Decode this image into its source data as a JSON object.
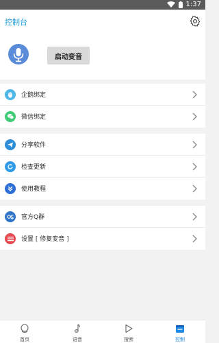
{
  "status_bar": {
    "time": "1:37"
  },
  "header": {
    "title": "控制台"
  },
  "hero": {
    "start_button_label": "启动变音"
  },
  "groups": [
    {
      "items": [
        {
          "label": "企鹅绑定",
          "icon": "penguin-icon",
          "color": "#4fb6e8"
        },
        {
          "label": "微信绑定",
          "icon": "wechat-icon",
          "color": "#3fca76"
        }
      ]
    },
    {
      "items": [
        {
          "label": "分享软件",
          "icon": "share-icon",
          "color": "#2f8ed8"
        },
        {
          "label": "检查更新",
          "icon": "refresh-icon",
          "color": "#2f9ae8"
        },
        {
          "label": "使用教程",
          "icon": "tutorial-icon",
          "color": "#2d6fd6"
        }
      ]
    },
    {
      "items": [
        {
          "label": "官方Q群",
          "icon": "group-icon",
          "color": "#2e75c9"
        },
        {
          "label": "设置 [ 修复变音 ]",
          "icon": "settings-list-icon",
          "color": "#e6484f"
        }
      ]
    }
  ],
  "tabs": [
    {
      "label": "首页",
      "icon": "home-icon",
      "active": false
    },
    {
      "label": "语音",
      "icon": "music-note-icon",
      "active": false
    },
    {
      "label": "搜索",
      "icon": "play-icon",
      "active": false
    },
    {
      "label": "控制",
      "icon": "control-icon",
      "active": true
    }
  ],
  "colors": {
    "accent": "#1e9bd7",
    "status_bar": "#5a5a5a",
    "tab_active": "#1e88e5"
  }
}
